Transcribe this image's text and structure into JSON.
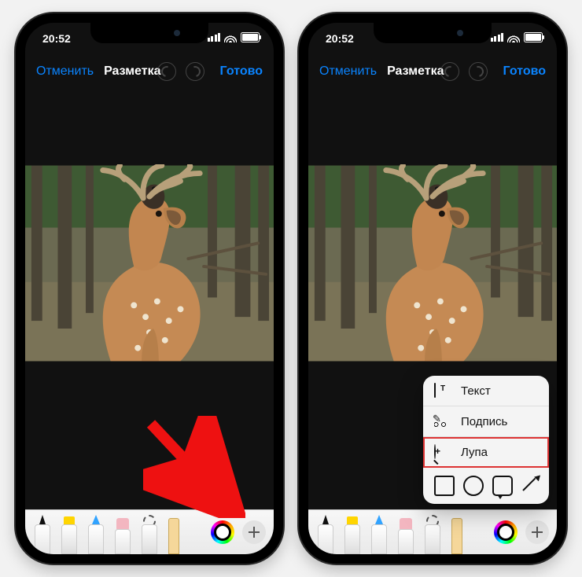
{
  "status": {
    "time": "20:52"
  },
  "nav": {
    "cancel": "Отменить",
    "title": "Разметка",
    "done": "Готово"
  },
  "tools": {
    "pen": "pen-tool",
    "highlighter": "highlighter-tool",
    "pencil": "pencil-tool",
    "eraser": "eraser-tool",
    "lasso": "lasso-tool",
    "ruler": "ruler-tool",
    "color": "color-picker",
    "add": "add-button"
  },
  "popup": {
    "text_label": "Текст",
    "signature_label": "Подпись",
    "loupe_label": "Лупа",
    "shapes": {
      "square": "square-shape",
      "circle": "circle-shape",
      "bubble": "speech-bubble-shape",
      "arrow": "arrow-shape"
    }
  },
  "colors": {
    "accent": "#0a84ff",
    "highlight_box": "#d33"
  }
}
